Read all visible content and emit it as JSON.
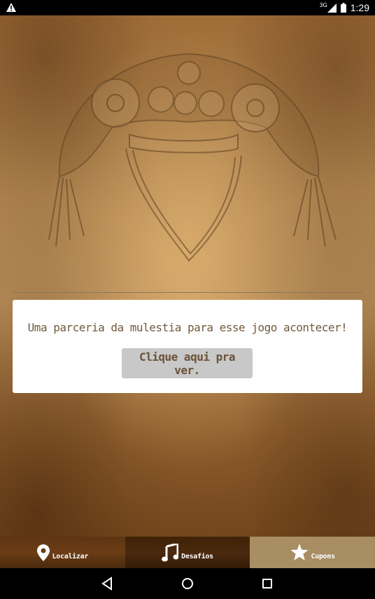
{
  "status_bar": {
    "network_type": "3G",
    "time": "1:29",
    "icons": [
      "warning-icon",
      "signal-icon",
      "battery-icon"
    ]
  },
  "card": {
    "message": "Uma parceria da mulestia para esse jogo acontecer!",
    "button_label": "Clique aqui pra ver."
  },
  "tabs": [
    {
      "label": "Localizar",
      "icon": "location-pin-icon",
      "active": false
    },
    {
      "label": "Desafios",
      "icon": "music-note-icon",
      "active": false
    },
    {
      "label": "Cupons",
      "icon": "star-icon",
      "active": true
    }
  ],
  "nav_bar": {
    "icons": [
      "back-icon",
      "home-icon",
      "recents-icon"
    ]
  },
  "colors": {
    "card_text": "#73583d",
    "button_bg": "#c8c8c8",
    "active_tab": "#a88e62",
    "tab_bar": "#5e3512"
  }
}
